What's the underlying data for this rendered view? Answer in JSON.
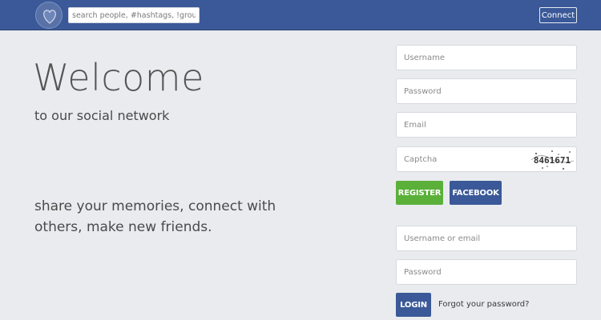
{
  "header": {
    "logo_icon": "heart-icon",
    "search_placeholder": "search people, #hashtags, !groups",
    "connect_label": "Connect",
    "bar_color": "#3b5998"
  },
  "hero": {
    "title": "Welcome",
    "subtitle": "to our social network",
    "tagline": "share your memories, connect with others, make new friends."
  },
  "register_form": {
    "username_placeholder": "Username",
    "password_placeholder": "Password",
    "email_placeholder": "Email",
    "captcha_placeholder": "Captcha",
    "captcha_text": "8461671",
    "register_label": "REGISTER",
    "facebook_label": "FACEBOOK",
    "register_color": "#5ab039",
    "facebook_color": "#3b5998"
  },
  "login_form": {
    "username_placeholder": "Username or email",
    "password_placeholder": "Password",
    "login_label": "LOGIN",
    "forgot_label": "Forgot your password?"
  }
}
